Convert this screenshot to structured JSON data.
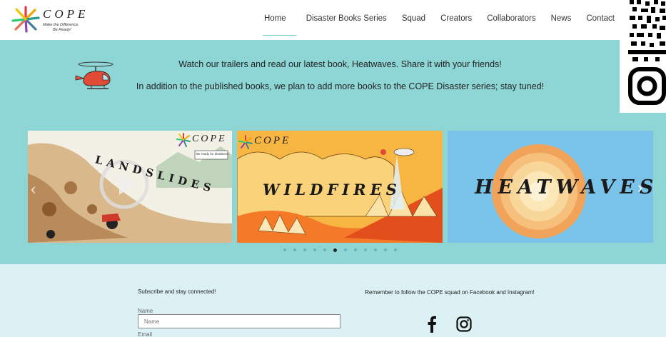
{
  "brand": {
    "title": "COPE",
    "tagline_1": "Make the Difference.",
    "tagline_2": "Be Ready!"
  },
  "nav": {
    "items": [
      "Home",
      "Disaster Books Series",
      "Squad",
      "Creators",
      "Collaborators",
      "News",
      "Contact"
    ],
    "active": "Home"
  },
  "intro": {
    "line1": "Watch our trailers and read our latest book, Heatwaves. Share it with your friends!",
    "line2": "In addition to the published books, we plan to add more books to the COPE Disaster series; stay tuned!"
  },
  "slides": [
    {
      "title": "LANDSLIDES",
      "logo": "COPE",
      "badge": "Be ready for disasters!"
    },
    {
      "title": "WILDFIRES",
      "logo": "COPE"
    },
    {
      "title": "HEATWAVES"
    }
  ],
  "carousel": {
    "dot_count": 12,
    "active_index": 5
  },
  "subscribe": {
    "title": "Subscribe and stay connected!",
    "name_label": "Name",
    "name_placeholder": "Name",
    "email_label": "Email"
  },
  "follow": {
    "text": "Remember to follow the COPE squad on Facebook and Instagram!"
  },
  "colors": {
    "teal": "#8ed6d6",
    "light": "#dcf1f4",
    "sky": "#79c3ea"
  }
}
